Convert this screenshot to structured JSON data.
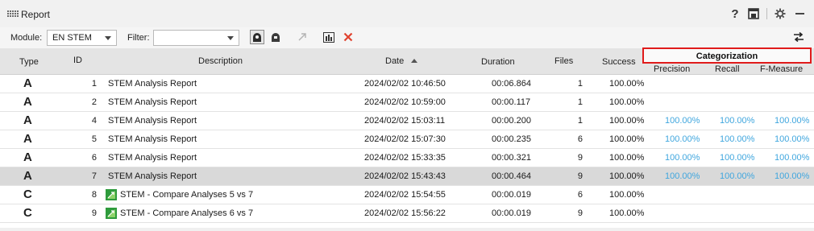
{
  "window": {
    "title": "Report"
  },
  "toolbar": {
    "module_label": "Module:",
    "module_value": "EN STEM",
    "filter_label": "Filter:",
    "filter_value": ""
  },
  "columns": {
    "type": "Type",
    "id": "ID",
    "description": "Description",
    "date": "Date",
    "duration": "Duration",
    "files": "Files",
    "success": "Success",
    "categorization": "Categorization",
    "precision": "Precision",
    "recall": "Recall",
    "fmeasure": "F-Measure"
  },
  "rows": [
    {
      "type": "A",
      "id": "1",
      "description": "STEM Analysis Report",
      "date": "2024/02/02 10:46:50",
      "duration": "00:06.864",
      "files": "1",
      "success": "100.00%",
      "precision": "",
      "recall": "",
      "fmeasure": ""
    },
    {
      "type": "A",
      "id": "2",
      "description": "STEM Analysis Report",
      "date": "2024/02/02 10:59:00",
      "duration": "00:00.117",
      "files": "1",
      "success": "100.00%",
      "precision": "",
      "recall": "",
      "fmeasure": ""
    },
    {
      "type": "A",
      "id": "4",
      "description": "STEM Analysis Report",
      "date": "2024/02/02 15:03:11",
      "duration": "00:00.200",
      "files": "1",
      "success": "100.00%",
      "precision": "100.00%",
      "recall": "100.00%",
      "fmeasure": "100.00%"
    },
    {
      "type": "A",
      "id": "5",
      "description": "STEM Analysis Report",
      "date": "2024/02/02 15:07:30",
      "duration": "00:00.235",
      "files": "6",
      "success": "100.00%",
      "precision": "100.00%",
      "recall": "100.00%",
      "fmeasure": "100.00%"
    },
    {
      "type": "A",
      "id": "6",
      "description": "STEM Analysis Report",
      "date": "2024/02/02 15:33:35",
      "duration": "00:00.321",
      "files": "9",
      "success": "100.00%",
      "precision": "100.00%",
      "recall": "100.00%",
      "fmeasure": "100.00%"
    },
    {
      "type": "A",
      "id": "7",
      "description": "STEM Analysis Report",
      "date": "2024/02/02 15:43:43",
      "duration": "00:00.464",
      "files": "9",
      "success": "100.00%",
      "precision": "100.00%",
      "recall": "100.00%",
      "fmeasure": "100.00%"
    },
    {
      "type": "C",
      "id": "8",
      "description": "STEM - Compare Analyses 5 vs 7",
      "date": "2024/02/02 15:54:55",
      "duration": "00:00.019",
      "files": "6",
      "success": "100.00%",
      "precision": "",
      "recall": "",
      "fmeasure": ""
    },
    {
      "type": "C",
      "id": "9",
      "description": "STEM - Compare Analyses 6 vs 7",
      "date": "2024/02/02 15:56:22",
      "duration": "00:00.019",
      "files": "9",
      "success": "100.00%",
      "precision": "",
      "recall": "",
      "fmeasure": ""
    }
  ],
  "selected_row_id": "7",
  "sort": {
    "column": "Date",
    "direction": "ascending"
  },
  "colors": {
    "highlight_box": "#e01b1b",
    "metric_text": "#3fa6de",
    "selected_row": "#d9d9d9",
    "header_bg": "#e4e4e4"
  },
  "icons": [
    "grip-icon",
    "help-icon",
    "export-icon",
    "settings-gear-icon",
    "minimize-icon",
    "filter-dropdown-icon",
    "analysis-icon",
    "analysis-alt-icon",
    "link-arrow-icon",
    "bar-chart-icon",
    "delete-x-icon",
    "swap-arrows-icon",
    "compare-icon"
  ]
}
